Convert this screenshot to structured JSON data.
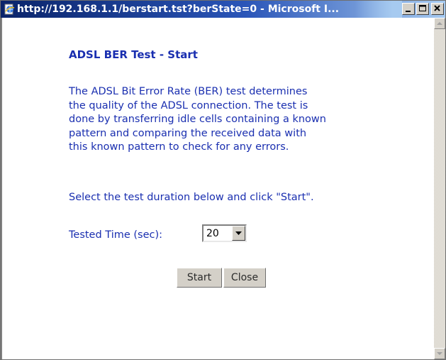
{
  "window": {
    "title": "http://192.168.1.1/berstart.tst?berState=0 - Microsoft I...",
    "minimize_icon": "minimize-icon",
    "maximize_icon": "maximize-icon",
    "close_icon": "close-icon",
    "app_icon": "ie-page-icon"
  },
  "page": {
    "heading": "ADSL BER Test - Start",
    "description_lines": [
      "The ADSL Bit Error Rate (BER) test determines",
      "the quality of the ADSL connection. The test is",
      "done by transferring idle cells containing a known",
      "pattern and comparing the received data with",
      "this known pattern to check for any errors."
    ],
    "instruction": "Select the test duration below and click \"Start\".",
    "duration_label": "Tested Time (sec):",
    "duration_value": "20",
    "start_label": "Start",
    "close_label": "Close"
  },
  "colors": {
    "text_blue": "#1a2fb0",
    "titlebar_dark": "#0a246a",
    "titlebar_light": "#a6caf0",
    "button_face": "#d4d0c8"
  }
}
